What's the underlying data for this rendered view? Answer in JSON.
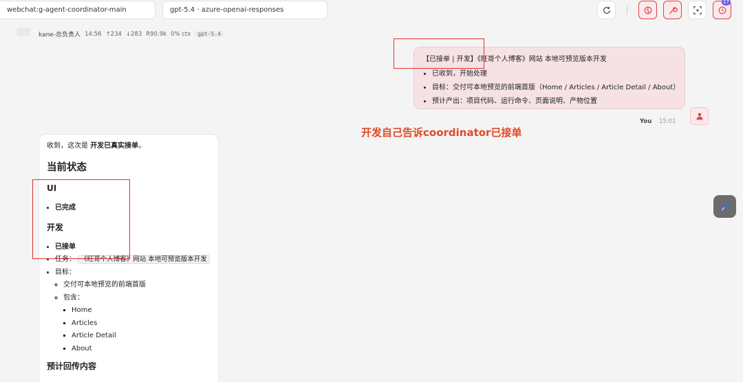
{
  "topbar": {
    "session": "webchat:g-agent-coordinator-main",
    "model": "gpt-5.4 · azure-openai-responses",
    "notification_count": "17"
  },
  "meta": {
    "author": "kane-总负责人",
    "time": "14:56",
    "up": "↑234",
    "down": "↓283",
    "r": "R90.9k",
    "ctx": "0% ctx",
    "model_tag": "gpt-5.4"
  },
  "user_message": {
    "title": "【已接单 | 开发】《旺哥个人博客》网站 本地可预览版本开发",
    "items": [
      "已收到，开始处理",
      "目标：交付可本地预览的前端首版（Home / Articles / Article Detail / About）",
      "预计产出：项目代码、运行命令、页面说明、产物位置"
    ],
    "sender": "You",
    "time": "15:01"
  },
  "annotation": "开发自己告诉coordinator已接单",
  "assistant": {
    "intro_prefix": "收到，这次是 ",
    "intro_bold": "开发已真实接单",
    "intro_suffix": "。",
    "heading_status": "当前状态",
    "ui_heading": "UI",
    "ui_item": "已完成",
    "dev_heading": "开发",
    "dev_item": "已接单",
    "task_label": "任务：",
    "task_value": "《旺哥个人博客》网站 本地可预览版本开发",
    "goal_label": "目标：",
    "goal_item": "交付可本地预览的前端首版",
    "include_label": "包含：",
    "pages": [
      "Home",
      "Articles",
      "Article Detail",
      "About"
    ],
    "heading_expected": "预计回传内容"
  },
  "colors": {
    "accent_red": "#e0302c",
    "annotation": "#e04a25",
    "badge": "#6d5ce6"
  }
}
